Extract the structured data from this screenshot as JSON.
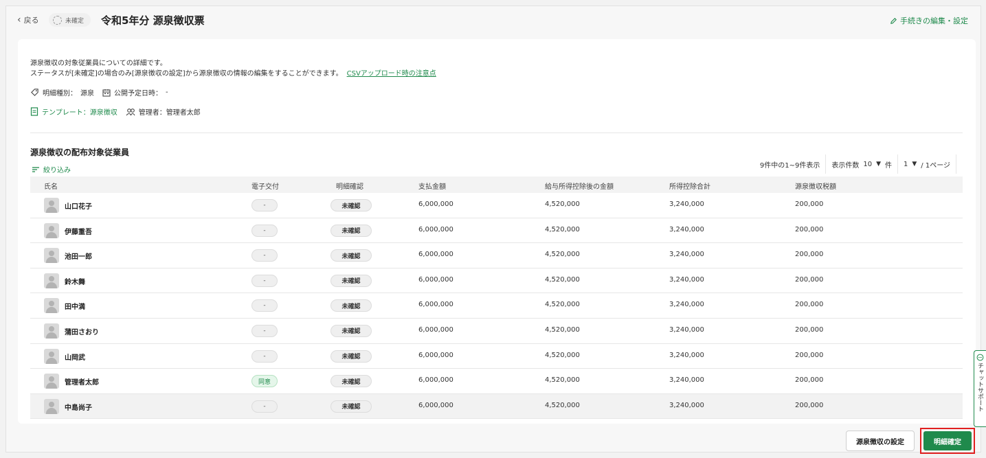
{
  "header": {
    "back_label": "戻る",
    "status_badge": "未確定",
    "title": "令和5年分 源泉徴収票",
    "edit_link": "手続きの編集・設定"
  },
  "info": {
    "line1": "源泉徴収の対象従業員についての詳細です。",
    "line2": "ステータスが[未確定]の場合のみ[源泉徴収の設定]から源泉徴収の情報の編集をすることができます。",
    "csv_link": "CSVアップロード時の注意点",
    "type_label": "明細種別：",
    "type_value": "源泉",
    "publish_label": "公開予定日時：",
    "publish_value": "-",
    "template_label": "テンプレート：源泉徴収",
    "manager_label": "管理者：管理者太郎"
  },
  "section": {
    "title": "源泉徴収の配布対象従業員",
    "filter_label": "絞り込み"
  },
  "pager": {
    "summary": "9件中の1~9件表示",
    "per_page_label": "表示件数",
    "per_page_value": "10",
    "per_page_unit": "件",
    "page_value": "1",
    "page_suffix": "/ 1ページ"
  },
  "table": {
    "columns": [
      "氏名",
      "電子交付",
      "明細確認",
      "支払金額",
      "給与所得控除後の金額",
      "所得控除合計",
      "源泉徴収税額"
    ],
    "rows": [
      {
        "name": "山口花子",
        "delivery": "-",
        "confirm": "未確認",
        "payment": "6,000,000",
        "after_deduction": "4,520,000",
        "deduction_total": "3,240,000",
        "tax": "200,000"
      },
      {
        "name": "伊藤重吾",
        "delivery": "-",
        "confirm": "未確認",
        "payment": "6,000,000",
        "after_deduction": "4,520,000",
        "deduction_total": "3,240,000",
        "tax": "200,000"
      },
      {
        "name": "池田一郎",
        "delivery": "-",
        "confirm": "未確認",
        "payment": "6,000,000",
        "after_deduction": "4,520,000",
        "deduction_total": "3,240,000",
        "tax": "200,000"
      },
      {
        "name": "鈴木舞",
        "delivery": "-",
        "confirm": "未確認",
        "payment": "6,000,000",
        "after_deduction": "4,520,000",
        "deduction_total": "3,240,000",
        "tax": "200,000"
      },
      {
        "name": "田中満",
        "delivery": "-",
        "confirm": "未確認",
        "payment": "6,000,000",
        "after_deduction": "4,520,000",
        "deduction_total": "3,240,000",
        "tax": "200,000"
      },
      {
        "name": "蒲田さおり",
        "delivery": "-",
        "confirm": "未確認",
        "payment": "6,000,000",
        "after_deduction": "4,520,000",
        "deduction_total": "3,240,000",
        "tax": "200,000"
      },
      {
        "name": "山岡武",
        "delivery": "-",
        "confirm": "未確認",
        "payment": "6,000,000",
        "after_deduction": "4,520,000",
        "deduction_total": "3,240,000",
        "tax": "200,000"
      },
      {
        "name": "管理者太郎",
        "delivery": "同意",
        "confirm": "未確認",
        "payment": "6,000,000",
        "after_deduction": "4,520,000",
        "deduction_total": "3,240,000",
        "tax": "200,000"
      },
      {
        "name": "中島尚子",
        "delivery": "-",
        "confirm": "未確認",
        "payment": "6,000,000",
        "after_deduction": "4,520,000",
        "deduction_total": "3,240,000",
        "tax": "200,000"
      }
    ]
  },
  "footer": {
    "settings_button": "源泉徴収の設定",
    "confirm_button": "明細確定"
  },
  "chat_support": "チャットサポート",
  "colors": {
    "accent": "#1f8a4c",
    "highlight_border": "#e02020"
  }
}
